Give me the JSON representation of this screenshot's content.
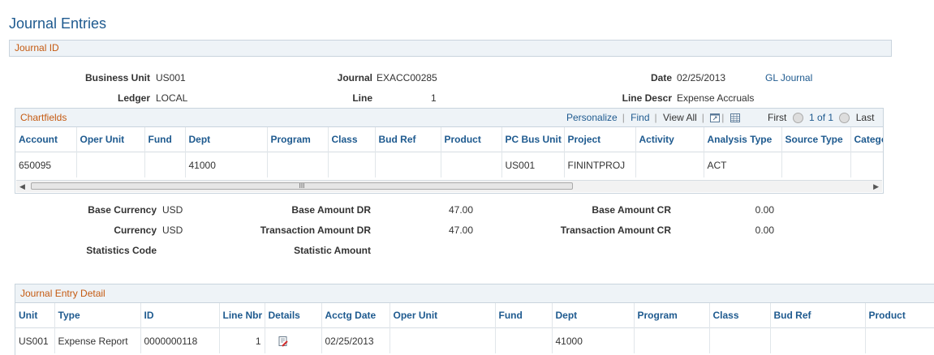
{
  "page_title": "Journal Entries",
  "journal_id_section": {
    "title": "Journal ID",
    "business_unit_label": "Business Unit",
    "business_unit_value": "US001",
    "journal_label": "Journal",
    "journal_value": "EXACC00285",
    "date_label": "Date",
    "date_value": "02/25/2013",
    "gl_journal_link": "GL Journal",
    "ledger_label": "Ledger",
    "ledger_value": "LOCAL",
    "line_label": "Line",
    "line_value": "1",
    "line_descr_label": "Line Descr",
    "line_descr_value": "Expense Accruals"
  },
  "chartfields": {
    "title": "Chartfields",
    "nav": {
      "personalize": "Personalize",
      "find": "Find",
      "view_all": "View All",
      "first": "First",
      "range": "1 of 1",
      "last": "Last"
    },
    "columns": [
      "Account",
      "Oper Unit",
      "Fund",
      "Dept",
      "Program",
      "Class",
      "Bud Ref",
      "Product",
      "PC Bus Unit",
      "Project",
      "Activity",
      "Analysis Type",
      "Source Type",
      "Catego"
    ],
    "rows": [
      [
        "650095",
        "",
        "",
        "41000",
        "",
        "",
        "",
        "",
        "US001",
        "FININTPROJ",
        "",
        "ACT",
        "",
        ""
      ]
    ],
    "scroll_thumb_label": "III"
  },
  "amounts": {
    "base_currency_label": "Base Currency",
    "base_currency_value": "USD",
    "base_amount_dr_label": "Base Amount DR",
    "base_amount_dr_value": "47.00",
    "base_amount_cr_label": "Base Amount CR",
    "base_amount_cr_value": "0.00",
    "currency_label": "Currency",
    "currency_value": "USD",
    "txn_amount_dr_label": "Transaction Amount DR",
    "txn_amount_dr_value": "47.00",
    "txn_amount_cr_label": "Transaction Amount CR",
    "txn_amount_cr_value": "0.00",
    "statistics_code_label": "Statistics Code",
    "statistic_amount_label": "Statistic Amount"
  },
  "journal_entry_detail": {
    "title": "Journal Entry Detail",
    "columns": [
      "Unit",
      "Type",
      "ID",
      "Line Nbr",
      "Details",
      "Acctg Date",
      "Oper Unit",
      "Fund",
      "Dept",
      "Program",
      "Class",
      "Bud Ref",
      "Product"
    ],
    "rows": [
      {
        "unit": "US001",
        "type": "Expense Report",
        "id": "0000000118",
        "line_nbr": "1",
        "details_icon": "report-detail-icon",
        "acctg_date": "02/25/2013",
        "oper_unit": "",
        "fund": "",
        "dept": "41000",
        "program": "",
        "class": "",
        "bud_ref": "",
        "product": ""
      }
    ]
  },
  "colors": {
    "title_blue": "#1e5a8f",
    "section_orange": "#c55a11",
    "header_bg": "#eef3f7"
  }
}
